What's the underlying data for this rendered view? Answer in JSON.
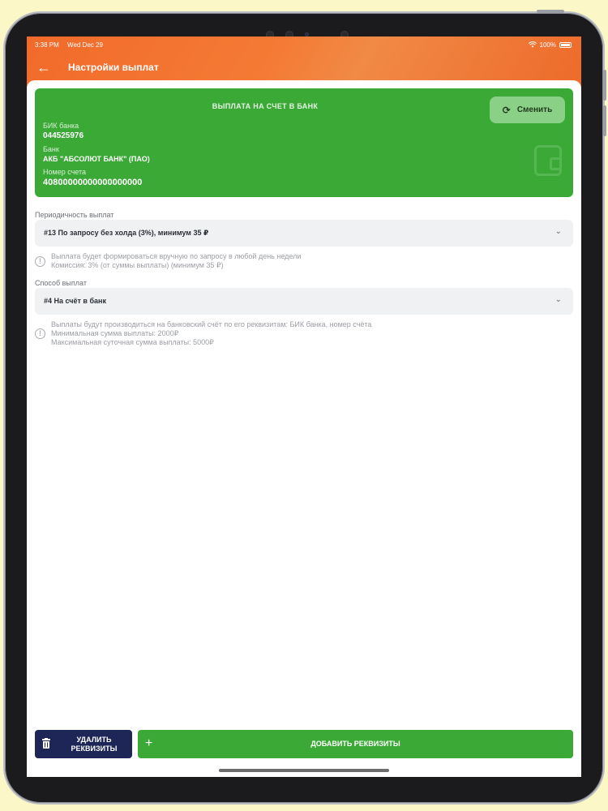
{
  "status_bar": {
    "time": "3:38 PM",
    "date": "Wed Dec 29",
    "battery": "100%"
  },
  "header": {
    "title": "Настройки выплат"
  },
  "bank_card": {
    "title": "ВЫПЛАТА НА СЧЕТ В БАНК",
    "change_label": "Сменить",
    "bik_label": "БИК банка",
    "bik_value": "044525976",
    "bank_label": "Банк",
    "bank_value": "АКБ \"АБСОЛЮТ БАНК\" (ПАО)",
    "account_label": "Номер счета",
    "account_value": "40800000000000000000"
  },
  "periodicity": {
    "label": "Периодичность выплат",
    "value": "#13 По запросу без холда (3%), минимум 35 ₽",
    "info_line1": "Выплата будет формироваться вручную по запросу в любой день недели",
    "info_line2": "Комиссия: 3% (от суммы выплаты) (минимум 35 ₽)"
  },
  "method": {
    "label": "Способ выплат",
    "value": "#4 На счёт в банк",
    "info_line1": "Выплаты будут производиться на банковский счёт по его реквизитам: БИК банка, номер счёта",
    "info_line2": "Минимальная сумма выплаты: 2000₽",
    "info_line3": "Максимальная суточная сумма выплаты: 5000₽"
  },
  "actions": {
    "delete_line1": "УДАЛИТЬ",
    "delete_line2": "РЕКВИЗИТЫ",
    "add_label": "ДОБАВИТЬ РЕКВИЗИТЫ"
  },
  "colors": {
    "accent_orange": "#f26a2a",
    "green": "#3aa935",
    "navy": "#1d2657"
  },
  "icons": [
    "back-arrow-icon",
    "wifi-icon",
    "battery-icon",
    "refresh-icon",
    "wallet-icon",
    "chevron-down-icon",
    "info-icon",
    "trash-icon",
    "plus-icon"
  ]
}
